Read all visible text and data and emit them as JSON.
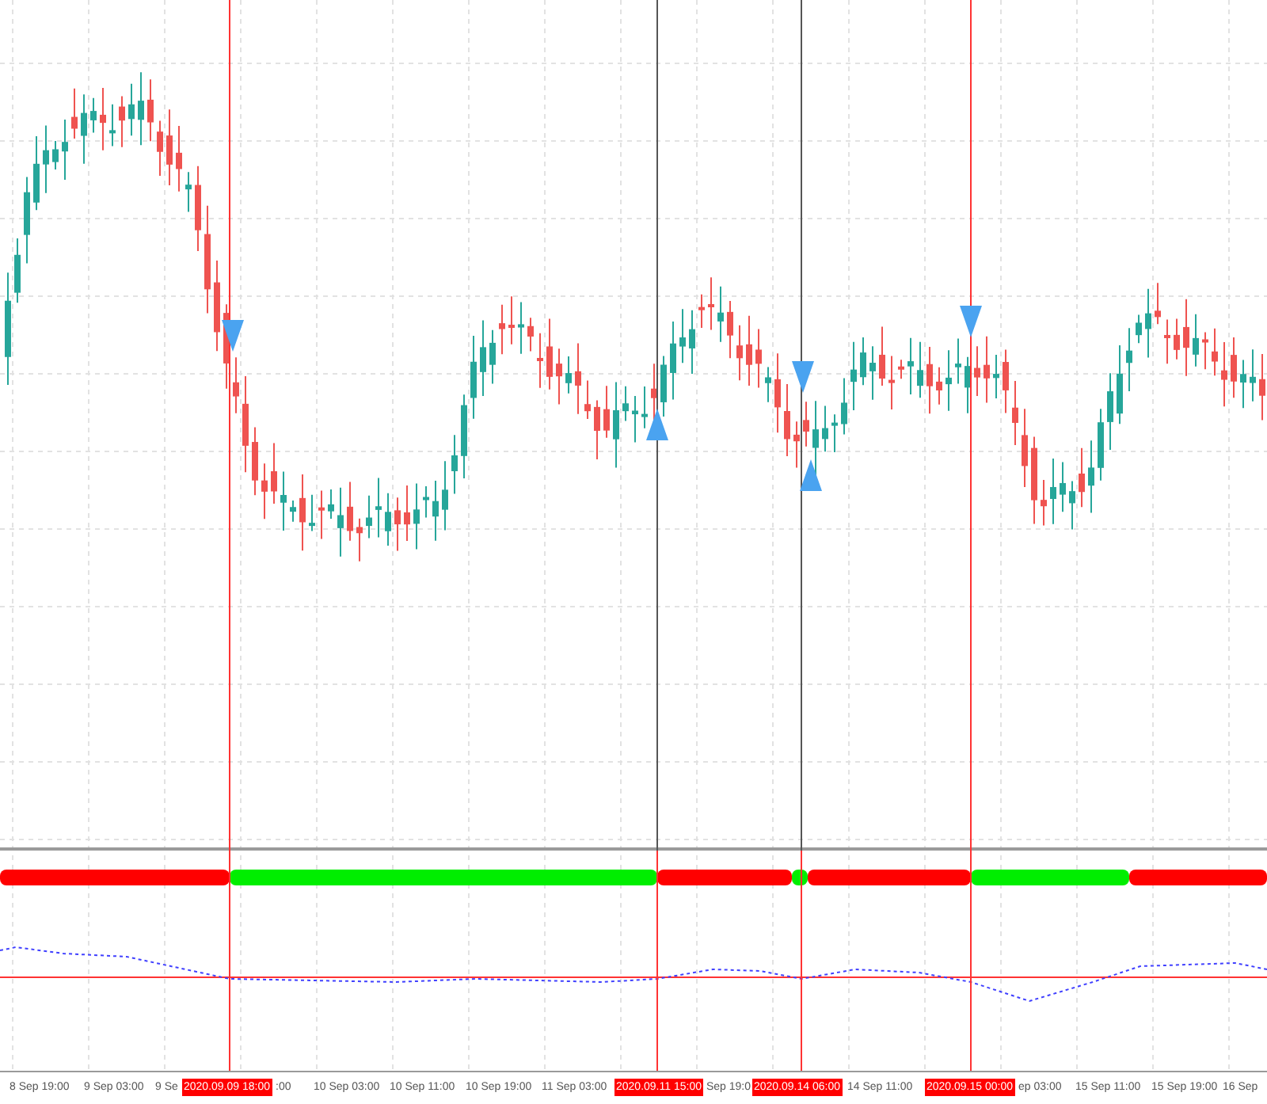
{
  "signal_bar": [
    {
      "color": "#ff0000"
    },
    {
      "color": "#00ee00"
    },
    {
      "color": "#ff0000"
    },
    {
      "color": "#00ee00"
    },
    {
      "color": "#ff0000"
    },
    {
      "color": "#00ee00"
    },
    {
      "color": "#ff0000"
    }
  ],
  "time_axis": [
    {
      "text": "8 Sep 19:00",
      "kind": "tick"
    },
    {
      "text": "9 Sep 03:00",
      "kind": "tick"
    },
    {
      "text": "9 Se",
      "kind": "tick"
    },
    {
      "text": "2020.09.09 18:00",
      "kind": "marker"
    },
    {
      "text": ":00",
      "kind": "tick"
    },
    {
      "text": "10 Sep 03:00",
      "kind": "tick"
    },
    {
      "text": "10 Sep 11:00",
      "kind": "tick"
    },
    {
      "text": "10 Sep 19:00",
      "kind": "tick"
    },
    {
      "text": "11 Sep 03:00",
      "kind": "tick"
    },
    {
      "text": "2020.09.11 15:00",
      "kind": "marker"
    },
    {
      "text": "Sep 19:0",
      "kind": "tick"
    },
    {
      "text": "2020.09.14 06:00",
      "kind": "marker"
    },
    {
      "text": "14 Sep 11:00",
      "kind": "tick"
    },
    {
      "text": "2020.09.15 00:00",
      "kind": "marker"
    },
    {
      "text": "ep 03:00",
      "kind": "tick"
    },
    {
      "text": "15 Sep 11:00",
      "kind": "tick"
    },
    {
      "text": "15 Sep 19:00",
      "kind": "tick"
    },
    {
      "text": "16 Sep",
      "kind": "tick"
    }
  ]
}
